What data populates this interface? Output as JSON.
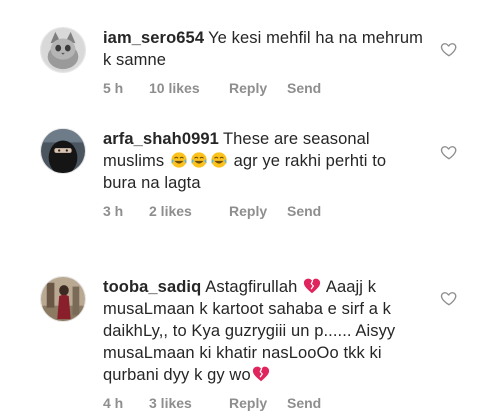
{
  "comments": [
    {
      "username": "iam_sero654",
      "text": "Ye kesi mehfil ha na mehrum k samne",
      "time": "5 h",
      "likes": "10 likes",
      "reply_label": "Reply",
      "send_label": "Send",
      "avatar_icon": "cat-avatar-icon"
    },
    {
      "username": "arfa_shah0991",
      "text_before": "These are seasonal muslims ",
      "emojis": [
        "face-with-tears-of-joy",
        "face-with-tears-of-joy",
        "face-with-tears-of-joy"
      ],
      "text_after": " agr ye rakhi perhti to bura na lagta",
      "time": "3 h",
      "likes": "2 likes",
      "reply_label": "Reply",
      "send_label": "Send",
      "avatar_icon": "niqab-avatar-icon"
    },
    {
      "username": "tooba_sadiq",
      "text_before": "Astagfirullah ",
      "emoji_mid": "broken-heart",
      "text_after": " Aaajj k musaLmaan k kartoot sahaba e sirf a k daikhLy,, to Kya guzrygiii un p...... Aisyy musaLmaan ki khatir nasLooOo tkk ki qurbani dyy k gy wo",
      "emoji_end": "broken-heart",
      "time": "4 h",
      "likes": "3 likes",
      "reply_label": "Reply",
      "send_label": "Send",
      "avatar_icon": "figure-avatar-icon"
    }
  ],
  "colors": {
    "text": "#262626",
    "meta": "#8e8e8e",
    "heart_outline": "#8e8e8e",
    "broken_heart": "#e0245e"
  },
  "icons": {
    "like": "heart-outline-icon"
  }
}
